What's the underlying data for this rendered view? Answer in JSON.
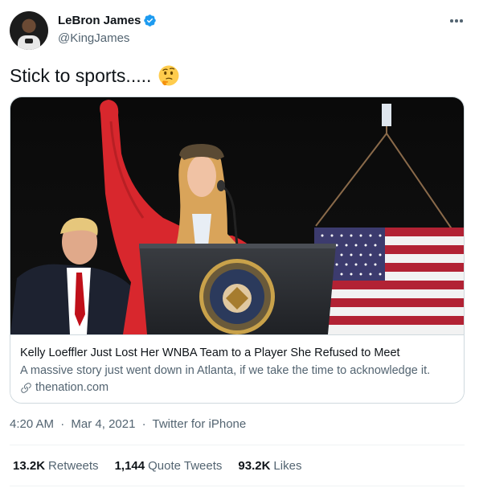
{
  "author": {
    "display_name": "LeBron James",
    "handle": "@KingJames",
    "verified": true,
    "avatar_icon": "avatar-photo"
  },
  "tweet": {
    "text": "Stick to sports.....",
    "emoji_icon": "thinking-face-icon"
  },
  "link_card": {
    "title": "Kelly Loeffler Just Lost Her WNBA Team to a Player She Refused to Meet",
    "description": "A massive story just went down in Atlanta, if we take the time to acknowledge it.",
    "domain": "thenation.com",
    "domain_icon": "link-icon"
  },
  "meta": {
    "time": "4:20 AM",
    "date": "Mar 4, 2021",
    "source": "Twitter for iPhone",
    "separator": "·"
  },
  "stats": {
    "retweets_count": "13.2K",
    "retweets_label": "Retweets",
    "quotes_count": "1,144",
    "quotes_label": "Quote Tweets",
    "likes_count": "93.2K",
    "likes_label": "Likes"
  },
  "colors": {
    "text_primary": "#0f1419",
    "text_secondary": "#536471",
    "verified_blue": "#1d9bf0",
    "border": "#cfd9de"
  }
}
